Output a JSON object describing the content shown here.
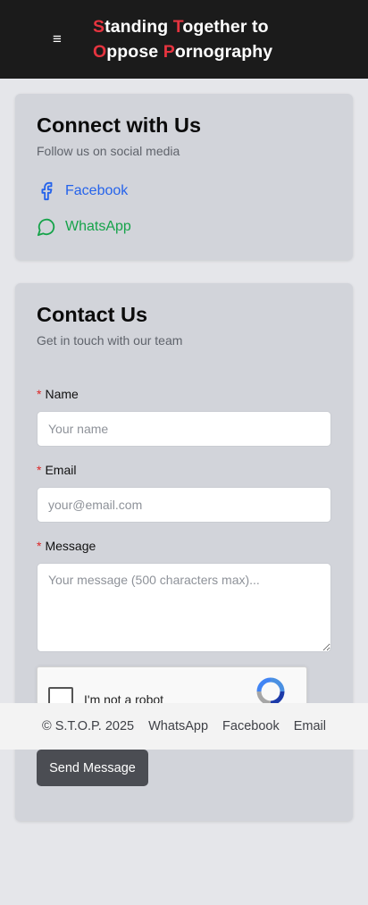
{
  "header": {
    "menu_icon": "≡",
    "brand_line1": [
      {
        "t": "S",
        "red": true
      },
      {
        "t": "tanding ",
        "red": false
      },
      {
        "t": "T",
        "red": true
      },
      {
        "t": "ogether to",
        "red": false
      }
    ],
    "brand_line2": [
      {
        "t": "O",
        "red": true
      },
      {
        "t": "ppose ",
        "red": false
      },
      {
        "t": "P",
        "red": true
      },
      {
        "t": "ornography",
        "red": false
      }
    ],
    "accent_color": "#e5343f"
  },
  "social": {
    "title": "Connect with Us",
    "subtitle": "Follow us on social media",
    "facebook_label": "Facebook",
    "whatsapp_label": "WhatsApp"
  },
  "contact": {
    "title": "Contact Us",
    "subtitle": "Get in touch with our team",
    "required_mark": "*",
    "name_label": "Name",
    "name_placeholder": "Your name",
    "email_label": "Email",
    "email_placeholder": "your@email.com",
    "message_label": "Message",
    "message_placeholder": "Your message (500 characters max)...",
    "captcha_text": "I'm not a robot",
    "send_label": "Send Message"
  },
  "footer": {
    "copyright": "© S.T.O.P. 2025",
    "links": [
      "WhatsApp",
      "Facebook",
      "Email"
    ]
  }
}
